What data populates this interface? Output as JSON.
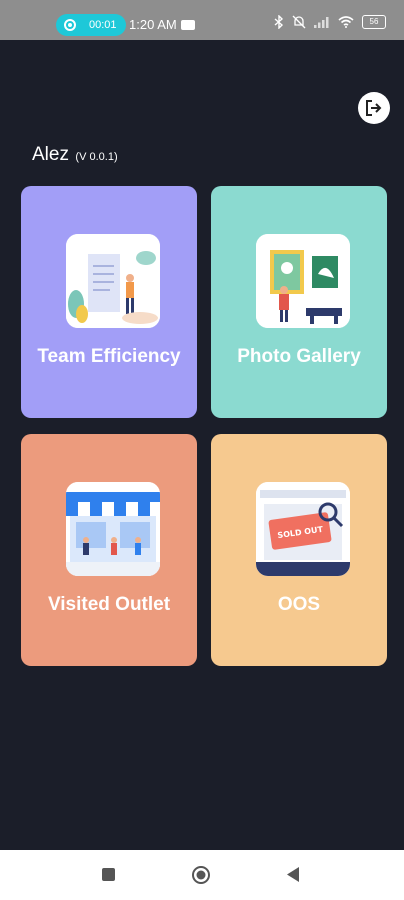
{
  "status_bar": {
    "recording_time": "00:01",
    "clock": "1:20 AM",
    "battery": "56"
  },
  "header": {
    "app_name": "Alez",
    "version": "(V 0.0.1)"
  },
  "cards": [
    {
      "label": "Team Efficiency",
      "color": "#a29ef7",
      "icon": "team-efficiency-illustration"
    },
    {
      "label": "Photo Gallery",
      "color": "#8bdad0",
      "icon": "photo-gallery-illustration"
    },
    {
      "label": "Visited Outlet",
      "color": "#ec9b7d",
      "icon": "storefront-illustration"
    },
    {
      "label": "OOS",
      "color": "#f6c98f",
      "icon": "sold-out-illustration",
      "sign_text": "SOLD OUT"
    }
  ],
  "logout": {
    "icon": "logout-icon"
  },
  "nav": {
    "items": [
      "recents-button",
      "home-button",
      "back-button"
    ]
  }
}
